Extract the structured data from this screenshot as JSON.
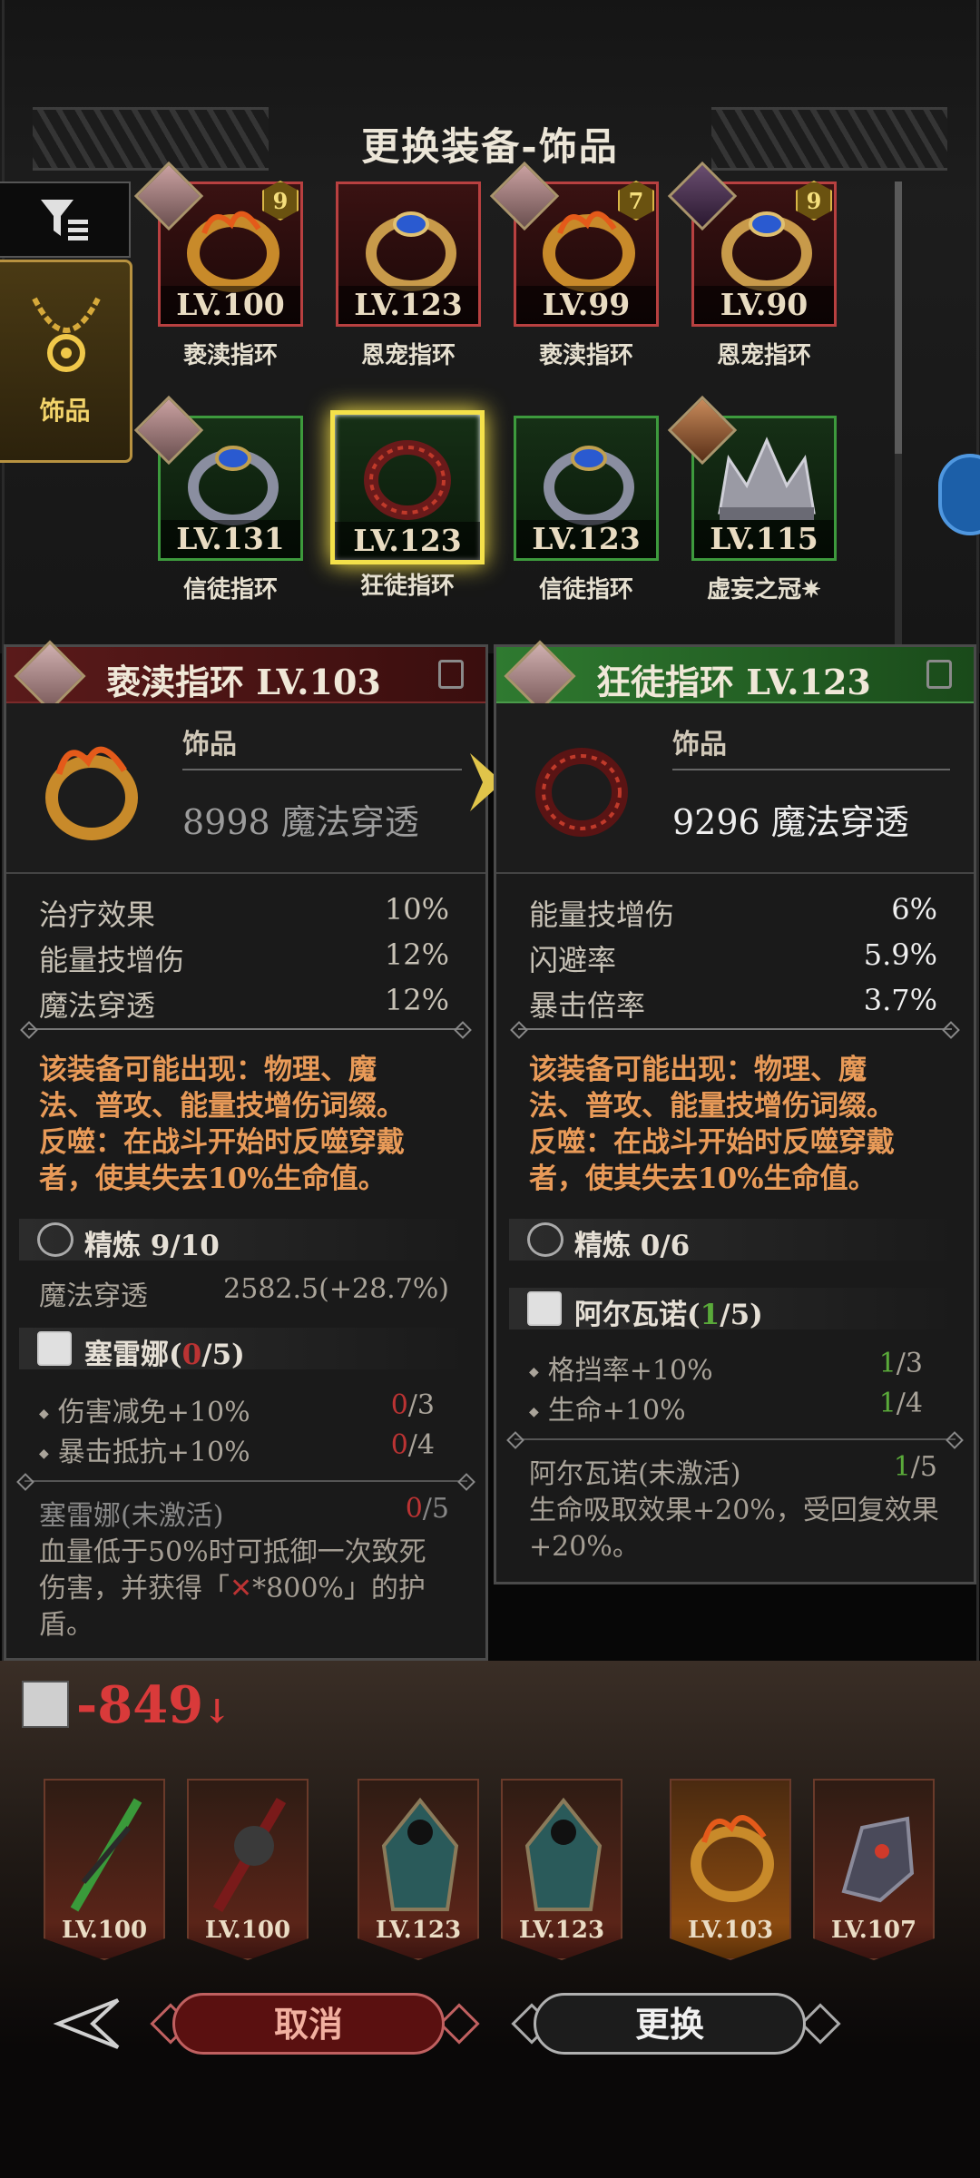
{
  "header": {
    "title": "更换装备-饰品"
  },
  "category": {
    "label": "饰品"
  },
  "inventory": [
    {
      "level": "LV.100",
      "name": "亵渎指环",
      "badge": "9",
      "rarity": "red"
    },
    {
      "level": "LV.123",
      "name": "恩宠指环",
      "badge": "",
      "rarity": "red"
    },
    {
      "level": "LV.99",
      "name": "亵渎指环",
      "badge": "7",
      "rarity": "red"
    },
    {
      "level": "LV.90",
      "name": "恩宠指环",
      "badge": "9",
      "rarity": "red"
    },
    {
      "level": "LV.131",
      "name": "信徒指环",
      "badge": "",
      "rarity": "green"
    },
    {
      "level": "LV.123",
      "name": "狂徒指环",
      "badge": "",
      "rarity": "green",
      "selected": true
    },
    {
      "level": "LV.123",
      "name": "信徒指环",
      "badge": "",
      "rarity": "green"
    },
    {
      "level": "LV.115",
      "name": "虚妄之冠✷",
      "badge": "",
      "rarity": "green"
    }
  ],
  "current": {
    "title": "亵渎指环 LV.103",
    "type": "饰品",
    "main_value": "8998 魔法穿透",
    "stats": [
      {
        "label": "治疗效果",
        "value": "10%"
      },
      {
        "label": "能量技增伤",
        "value": "12%"
      },
      {
        "label": "魔法穿透",
        "value": "12%"
      }
    ],
    "desc": [
      "该装备可能出现：物理、魔",
      "法、普攻、能量技增伤词缀。",
      "反噬：在战斗开始时反噬穿戴",
      "者，使其失去10%生命值。"
    ],
    "refine_label": "精炼 9/10",
    "refine_stat": {
      "label": "魔法穿透",
      "value": "2582.5(+28.7%)"
    },
    "set_name": "塞雷娜(",
    "set_count": "0",
    "set_total": "/5)",
    "set_bonuses": [
      {
        "label": "伤害减免+10%",
        "have": "0",
        "need": "/3"
      },
      {
        "label": "暴击抵抗+10%",
        "have": "0",
        "need": "/4"
      }
    ],
    "set_status": {
      "label": "塞雷娜(未激活)",
      "have": "0",
      "need": "/5"
    },
    "set_text": [
      "血量低于50%时可抵御一次致死",
      "伤害，并获得「",
      "*800%」的护",
      "盾。"
    ]
  },
  "candidate": {
    "title": "狂徒指环 LV.123",
    "type": "饰品",
    "main_value": "9296 魔法穿透",
    "stats": [
      {
        "label": "能量技增伤",
        "value": "6%"
      },
      {
        "label": "闪避率",
        "value": "5.9%"
      },
      {
        "label": "暴击倍率",
        "value": "3.7%"
      }
    ],
    "desc": [
      "该装备可能出现：物理、魔",
      "法、普攻、能量技增伤词缀。",
      "反噬：在战斗开始时反噬穿戴",
      "者，使其失去10%生命值。"
    ],
    "refine_label": "精炼 0/6",
    "set_name": "阿尔瓦诺(",
    "set_count": "1",
    "set_total": "/5)",
    "set_bonuses": [
      {
        "label": "格挡率+10%",
        "have": "1",
        "need": "/3"
      },
      {
        "label": "生命+10%",
        "have": "1",
        "need": "/4"
      }
    ],
    "set_status": {
      "label": "阿尔瓦诺(未激活)",
      "have": "1",
      "need": "/5"
    },
    "set_text": [
      "生命吸取效果+20%，受回复效果",
      "+20%。"
    ]
  },
  "score": {
    "value": "-849",
    "arrow": "↓"
  },
  "equipped": [
    {
      "level": "LV.100"
    },
    {
      "level": "LV.100"
    },
    {
      "level": "LV.123"
    },
    {
      "level": "LV.123"
    },
    {
      "level": "LV.103",
      "active": true
    },
    {
      "level": "LV.107"
    }
  ],
  "buttons": {
    "cancel": "取消",
    "replace": "更换"
  },
  "colors": {
    "red_rarity": "#b84040",
    "green_rarity": "#3d9a3d",
    "selected": "#f4e14a",
    "desc": "#e89a58",
    "score": "#d93a3a"
  }
}
